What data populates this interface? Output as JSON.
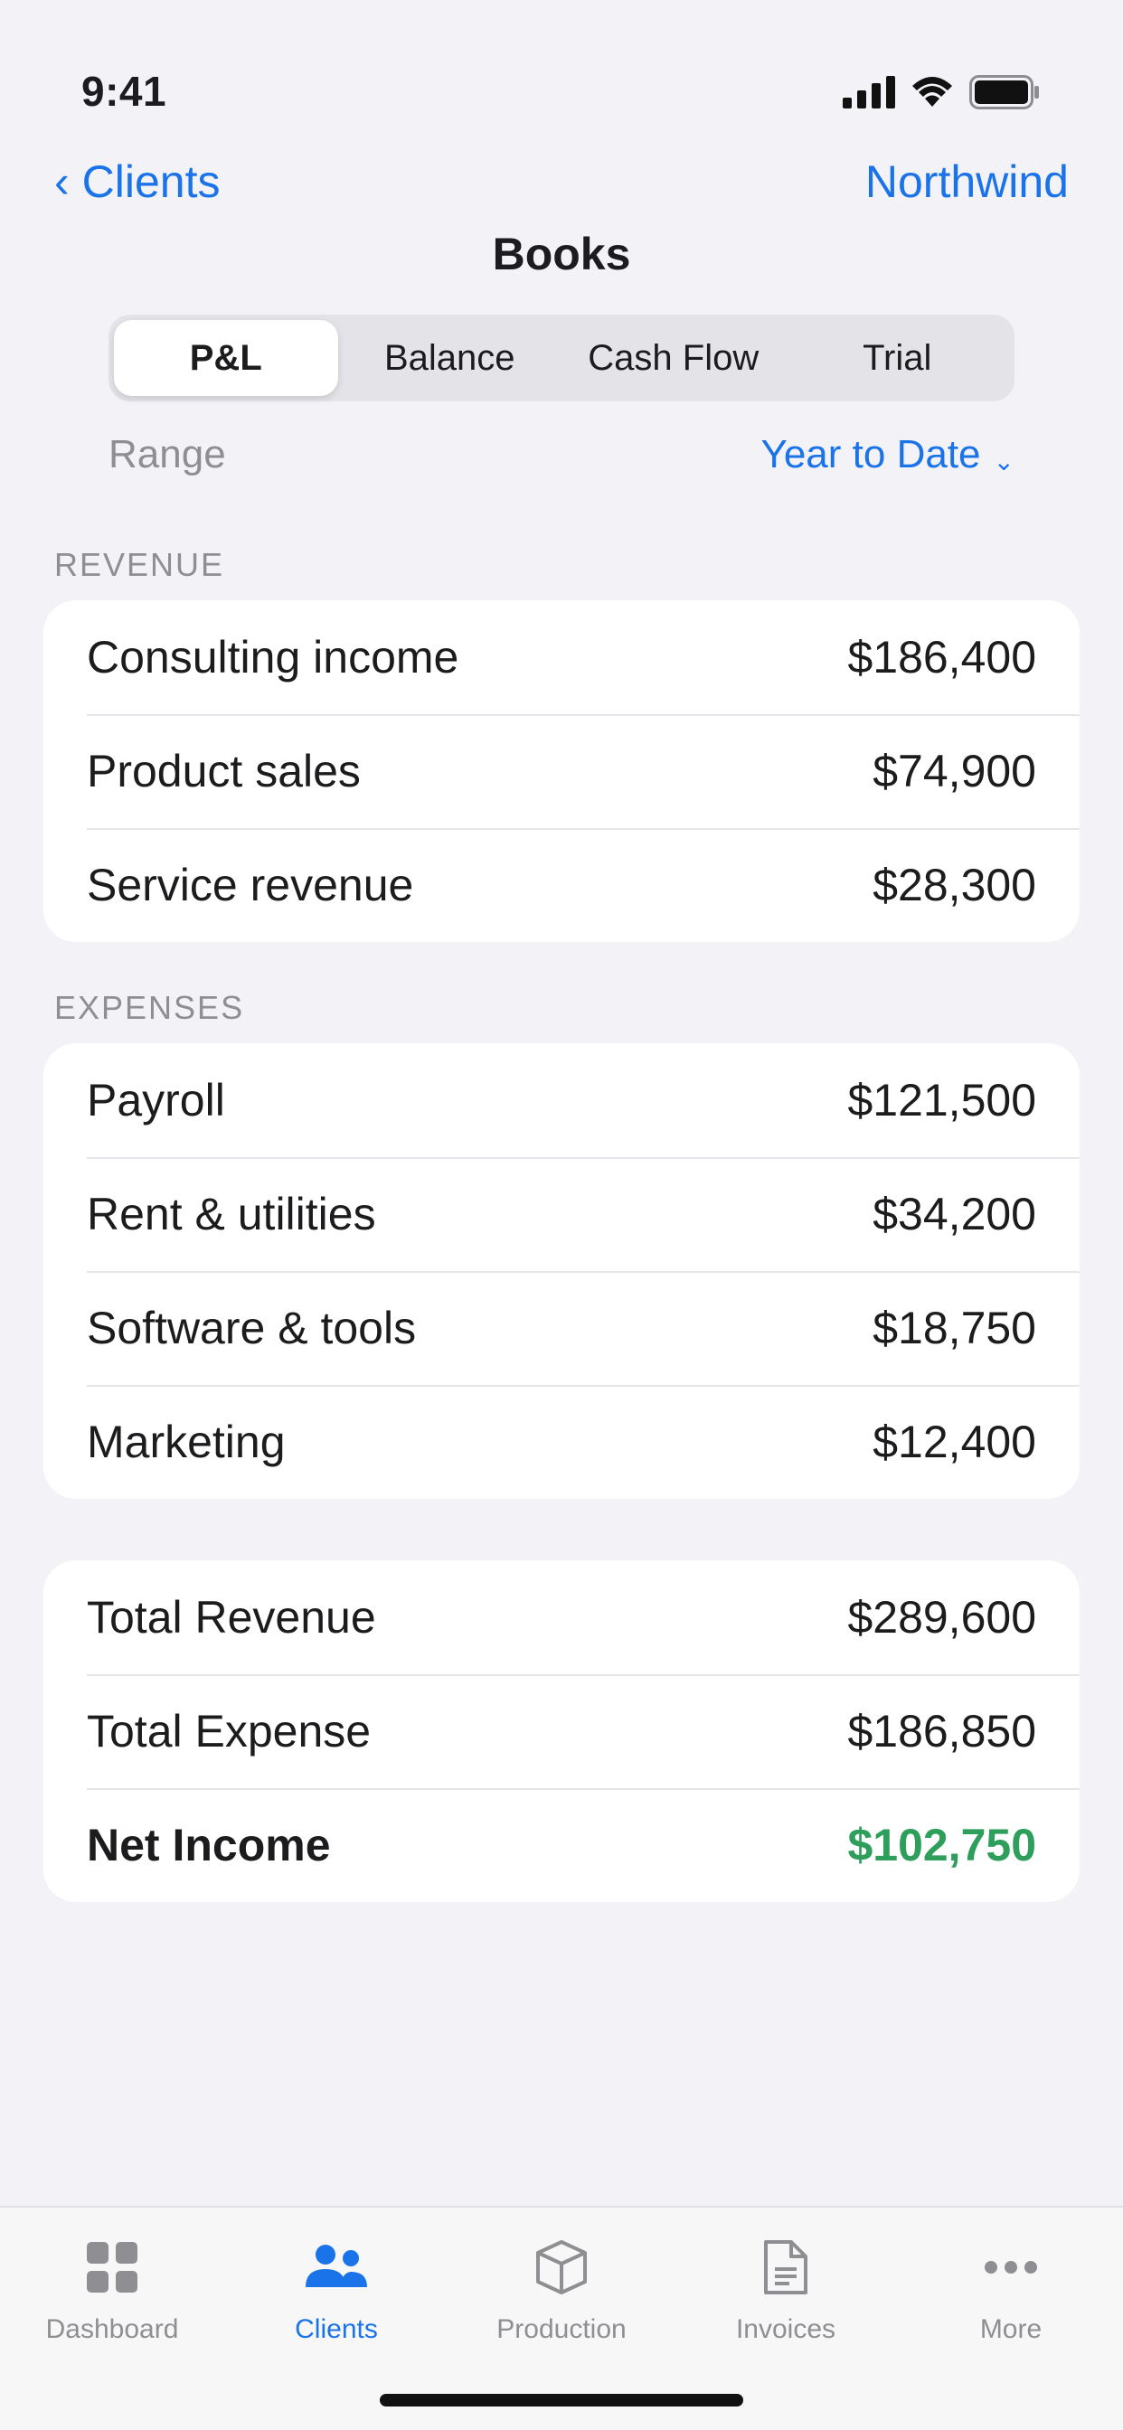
{
  "status_bar": {
    "time": "9:41"
  },
  "nav": {
    "back_label": "Clients",
    "title": "Books",
    "right_label": "Northwind"
  },
  "segments": [
    {
      "label": "P&L",
      "selected": true
    },
    {
      "label": "Balance",
      "selected": false
    },
    {
      "label": "Cash Flow",
      "selected": false
    },
    {
      "label": "Trial",
      "selected": false
    }
  ],
  "range": {
    "label": "Range",
    "value": "Year to Date"
  },
  "revenue": {
    "header": "REVENUE",
    "rows": [
      {
        "label": "Consulting income",
        "amount": "$186,400"
      },
      {
        "label": "Product sales",
        "amount": "$74,900"
      },
      {
        "label": "Service revenue",
        "amount": "$28,300"
      }
    ]
  },
  "expenses": {
    "header": "EXPENSES",
    "rows": [
      {
        "label": "Payroll",
        "amount": "$121,500"
      },
      {
        "label": "Rent & utilities",
        "amount": "$34,200"
      },
      {
        "label": "Software & tools",
        "amount": "$18,750"
      },
      {
        "label": "Marketing",
        "amount": "$12,400"
      }
    ]
  },
  "summary": {
    "total_revenue_label": "Total Revenue",
    "total_revenue": "$289,600",
    "total_expense_label": "Total Expense",
    "total_expense": "$186,850",
    "net_income_label": "Net Income",
    "net_income": "$102,750"
  },
  "tabbar": [
    {
      "label": "Dashboard",
      "icon": "grid-icon",
      "active": false
    },
    {
      "label": "Clients",
      "icon": "people-icon",
      "active": true
    },
    {
      "label": "Production",
      "icon": "box-icon",
      "active": false
    },
    {
      "label": "Invoices",
      "icon": "document-icon",
      "active": false
    },
    {
      "label": "More",
      "icon": "ellipsis-icon",
      "active": false
    }
  ],
  "colors": {
    "accent": "#1a73e8",
    "positive": "#2e9e5b",
    "background": "#f2f2f7"
  }
}
